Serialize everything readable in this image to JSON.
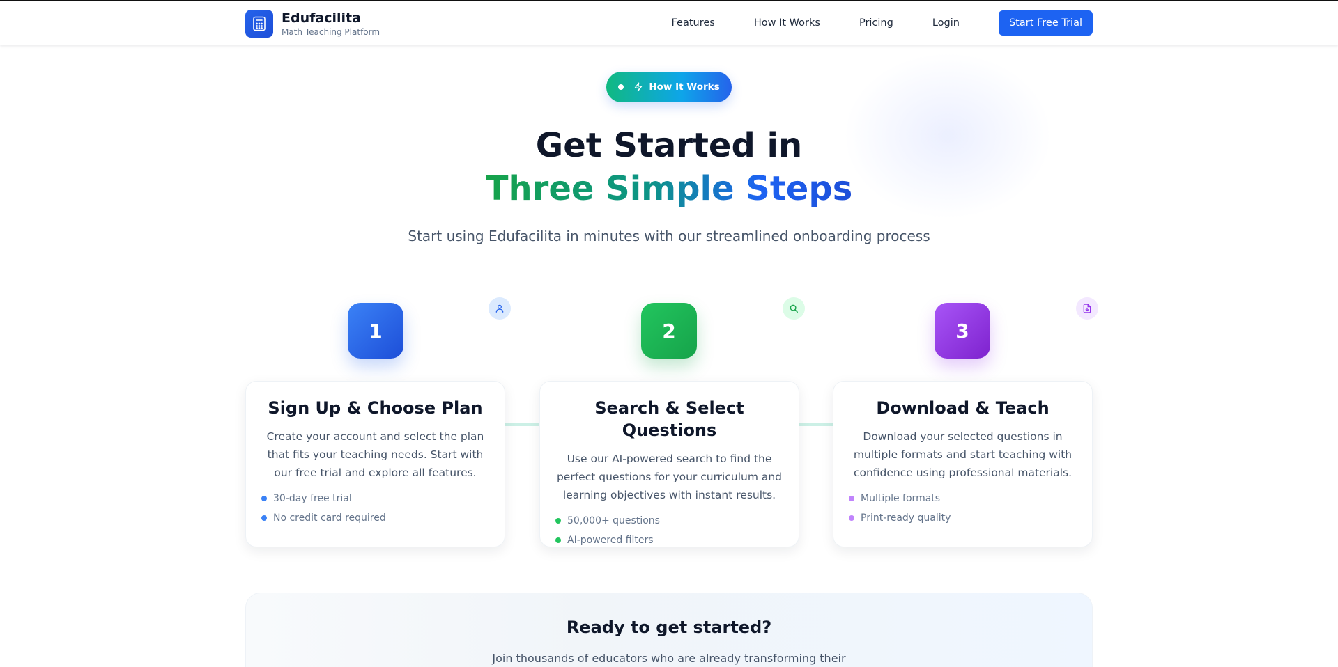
{
  "nav": {
    "brand_name": "Edufacilita",
    "brand_tagline": "Math Teaching Platform",
    "links": [
      "Features",
      "How It Works",
      "Pricing",
      "Login"
    ],
    "cta_label": "Start Free Trial"
  },
  "hero": {
    "badge_label": "How It Works",
    "title_line1": "Get Started in",
    "title_line2": "Three Simple Steps",
    "subtitle": "Start using Edufacilita in minutes with our streamlined onboarding process"
  },
  "steps": [
    {
      "number": "1",
      "icon": "user-icon",
      "title": "Sign Up & Choose Plan",
      "description": "Create your account and select the plan that fits your teaching needs. Start with our free trial and explore all features.",
      "features": [
        "30-day free trial",
        "No credit card required"
      ],
      "color": "#2563eb"
    },
    {
      "number": "2",
      "icon": "search-icon",
      "title": "Search & Select Questions",
      "description": "Use our AI-powered search to find the perfect questions for your curriculum and learning objectives with instant results.",
      "features": [
        "50,000+ questions",
        "AI-powered filters"
      ],
      "color": "#16a34a"
    },
    {
      "number": "3",
      "icon": "file-download-icon",
      "title": "Download & Teach",
      "description": "Download your selected questions in multiple formats and start teaching with confidence using professional materials.",
      "features": [
        "Multiple formats",
        "Print-ready quality"
      ],
      "color": "#9333ea"
    }
  ],
  "cta": {
    "title": "Ready to get started?",
    "text": "Join thousands of educators who are already transforming their"
  },
  "colors": {
    "primary": "#1d63f2",
    "green": "#16a34a",
    "purple": "#9333ea",
    "text": "#0f172a"
  }
}
